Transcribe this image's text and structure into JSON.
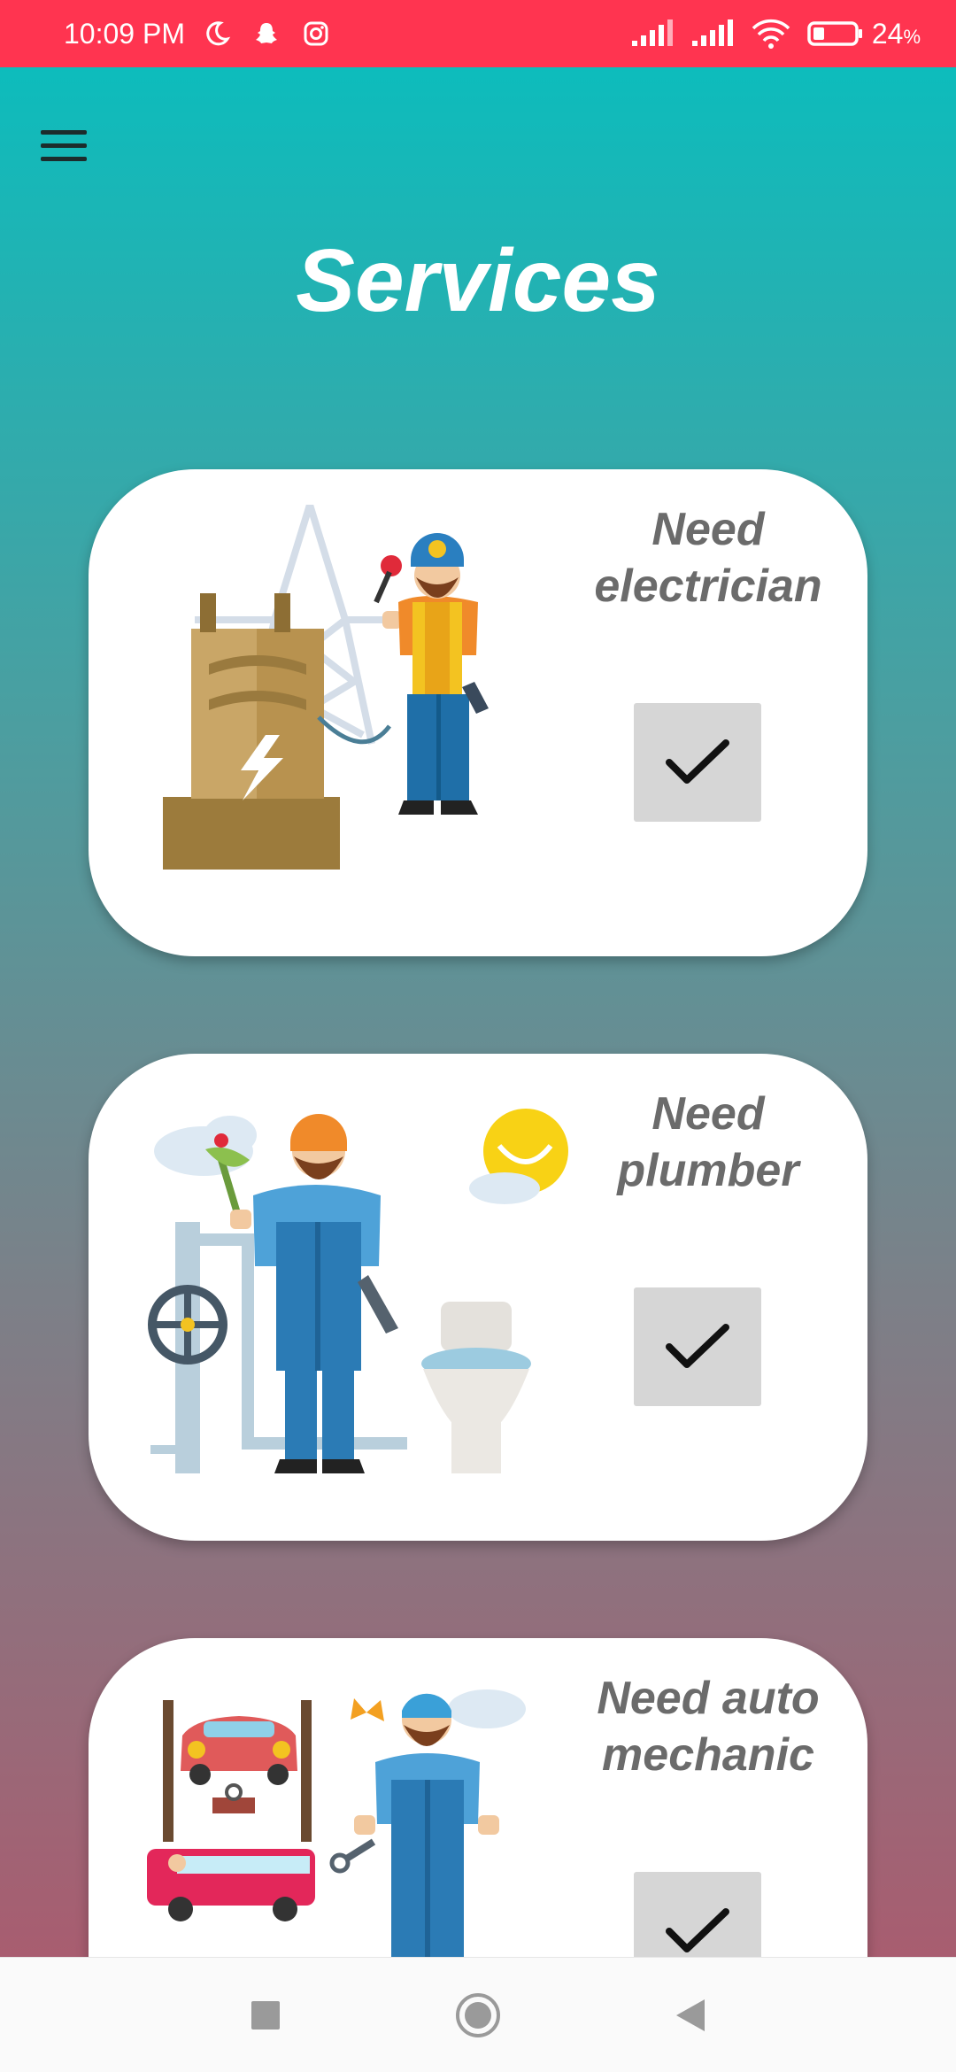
{
  "status_bar": {
    "time": "10:09 PM",
    "battery_percent": "24",
    "battery_suffix": "%",
    "icons_left": [
      "moon-icon",
      "snapchat-icon",
      "instagram-icon"
    ],
    "icons_right": [
      "signal-icon",
      "signal-icon",
      "wifi-icon",
      "battery-icon"
    ],
    "background_color": "#ff3450"
  },
  "header": {
    "title": "Services",
    "menu_icon": "hamburger-menu-icon"
  },
  "services": [
    {
      "label_line1": "Need",
      "label_line2": "electrician",
      "illustration": "electrician-illustration",
      "checked": true
    },
    {
      "label_line1": "Need",
      "label_line2": "plumber",
      "illustration": "plumber-illustration",
      "checked": true
    },
    {
      "label_line1": "Need auto",
      "label_line2": "mechanic",
      "illustration": "mechanic-illustration",
      "checked": true
    }
  ],
  "nav_bar": {
    "buttons": [
      "recent-apps-icon",
      "home-icon",
      "back-icon"
    ]
  },
  "colors": {
    "gradient_top": "#0dbcbc",
    "gradient_bottom": "#a85d70",
    "card_label": "#6b6b6b",
    "check_button": "#d6d6d6"
  }
}
